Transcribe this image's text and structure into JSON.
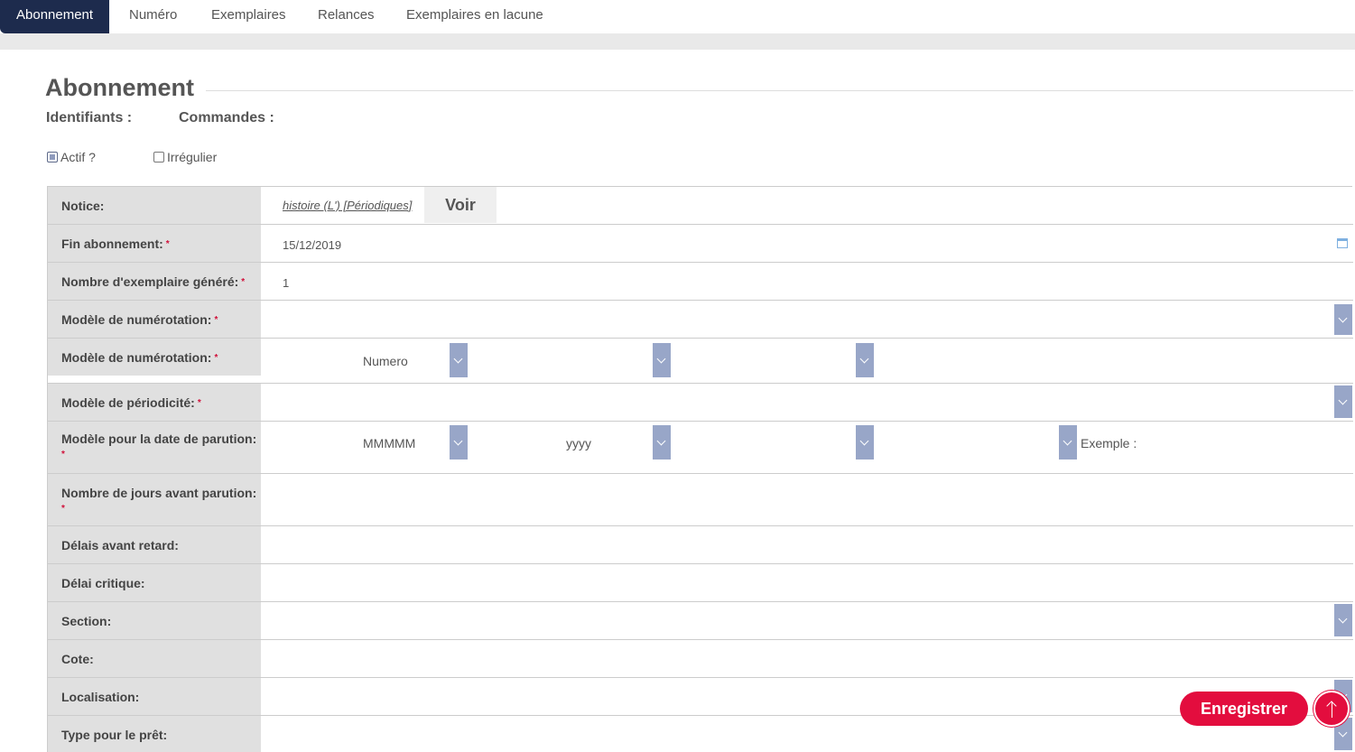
{
  "tabs": [
    {
      "label": "Abonnement",
      "active": true
    },
    {
      "label": "Numéro"
    },
    {
      "label": "Exemplaires"
    },
    {
      "label": "Relances"
    },
    {
      "label": "Exemplaires en lacune"
    }
  ],
  "header": {
    "title": "Abonnement",
    "identifiants_label": "Identifiants :",
    "commandes_label": "Commandes :"
  },
  "checkboxes": {
    "actif": {
      "label": "Actif ?",
      "checked": true
    },
    "irregulier": {
      "label": "Irrégulier",
      "checked": false
    }
  },
  "form": {
    "notice": {
      "label": "Notice:",
      "link": "histoire (L') [Périodiques]",
      "button": "Voir"
    },
    "fin_abonnement": {
      "label": "Fin abonnement:",
      "value": "15/12/2019"
    },
    "nombre_exemplaire": {
      "label": "Nombre d'exemplaire généré:",
      "value": "1"
    },
    "modele_numerotation_1": {
      "label": "Modèle de numérotation:"
    },
    "modele_numerotation_2": {
      "label": "Modèle de numérotation:",
      "select1": "Numero"
    },
    "modele_periodicite": {
      "label": "Modèle de périodicité:"
    },
    "modele_date": {
      "label": "Modèle pour la date de parution:",
      "select1": "MMMMM",
      "select2": "yyyy",
      "exemple": "Exemple :"
    },
    "nombre_jours": {
      "label": "Nombre de jours avant parution:"
    },
    "delais_retard": {
      "label": "Délais avant retard:"
    },
    "delai_critique": {
      "label": "Délai critique:"
    },
    "section": {
      "label": "Section:"
    },
    "cote": {
      "label": "Cote:"
    },
    "localisation": {
      "label": "Localisation:"
    },
    "type_pret": {
      "label": "Type pour le prêt:"
    }
  },
  "required_mark": "*",
  "actions": {
    "save": "Enregistrer"
  },
  "colors": {
    "accent": "#e30d3e",
    "tab_active": "#1d2b4d",
    "select_arrow": "#98a6c8"
  }
}
